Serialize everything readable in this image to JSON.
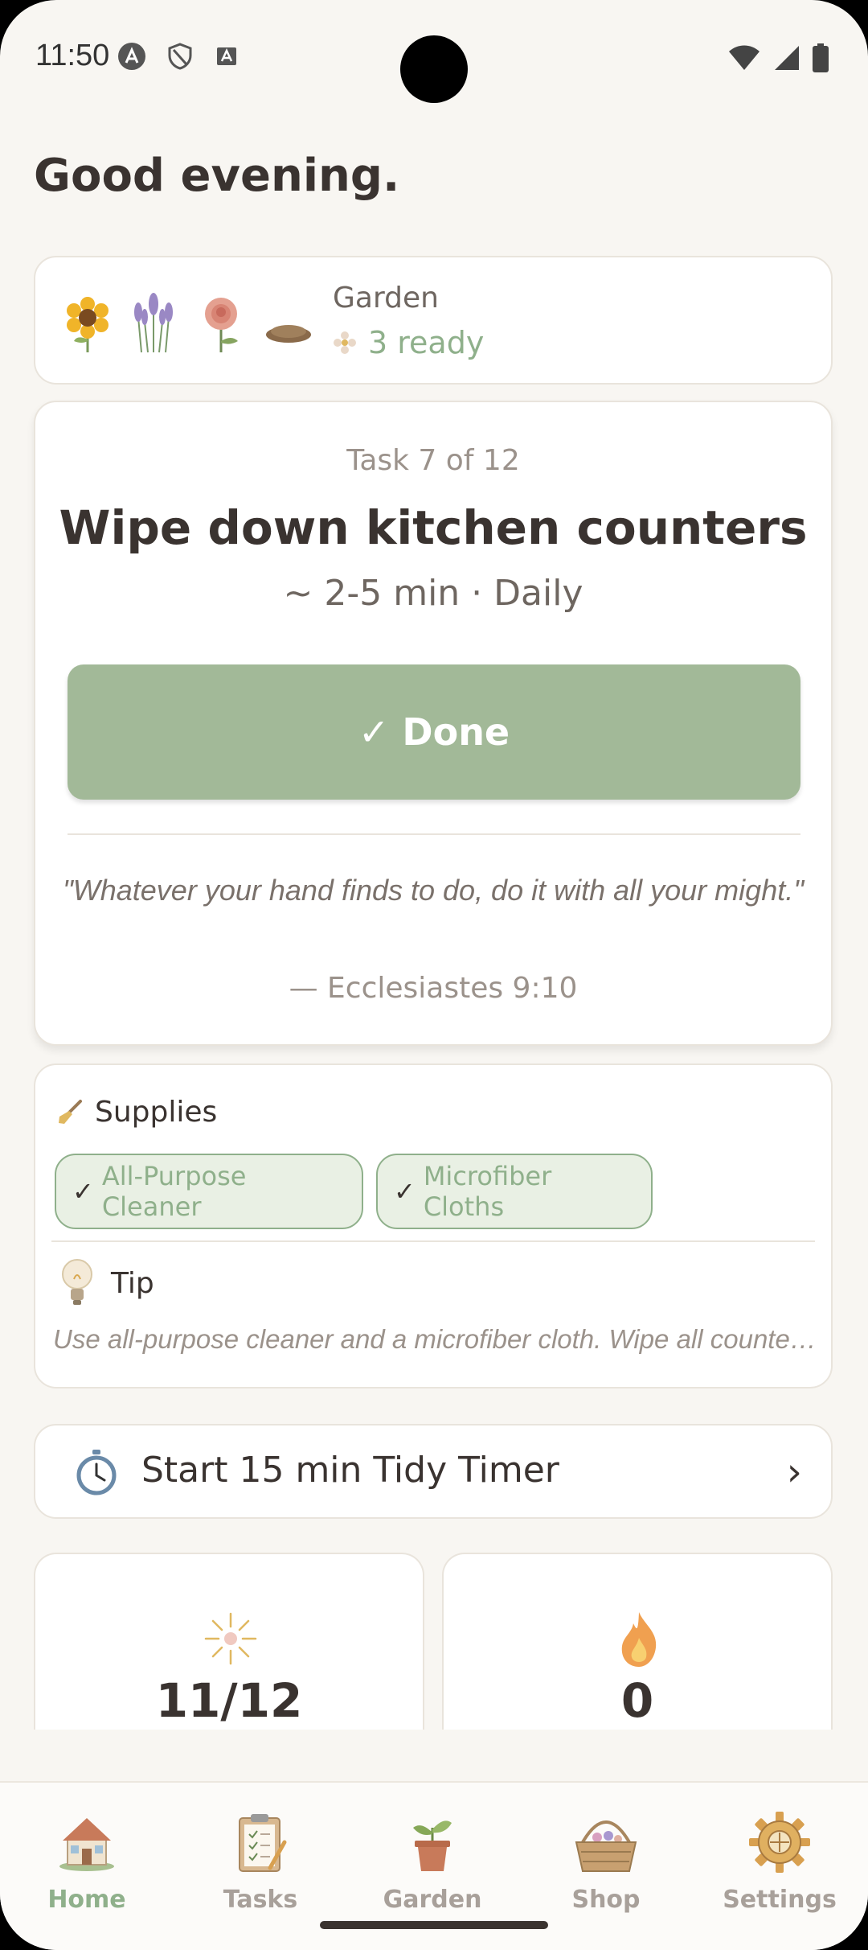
{
  "status_bar": {
    "time": "11:50"
  },
  "greeting": "Good evening.",
  "garden": {
    "title": "Garden",
    "ready": "3 ready"
  },
  "task": {
    "counter": "Task 7 of 12",
    "title": "Wipe down kitchen counters",
    "meta": "~ 2-5 min · Daily",
    "done_label": "✓ Done",
    "quote": "\"Whatever your hand finds to do, do it with all your might.\"",
    "verse": "— Ecclesiastes 9:10"
  },
  "supplies": {
    "title": "Supplies",
    "items": [
      {
        "check": "✓",
        "label": "All-Purpose Cleaner"
      },
      {
        "check": "✓",
        "label": "Microfiber Cloths"
      }
    ],
    "tip_title": "Tip",
    "tip_text": "Use all-purpose cleaner and a microfiber cloth. Wipe all counters, including the back splash and around appliances."
  },
  "timer": {
    "label": "Start 15 min Tidy Timer",
    "chevron": "›"
  },
  "stats": [
    {
      "icon": "sparkle-icon",
      "value": "11/12"
    },
    {
      "icon": "flame-icon",
      "value": "0"
    }
  ],
  "nav": [
    {
      "label": "Home",
      "icon": "house-icon",
      "active": true
    },
    {
      "label": "Tasks",
      "icon": "clipboard-icon"
    },
    {
      "label": "Garden",
      "icon": "plant-pot-icon"
    },
    {
      "label": "Shop",
      "icon": "basket-icon"
    },
    {
      "label": "Settings",
      "icon": "gear-icon"
    }
  ],
  "colors": {
    "accent": "#a2b998",
    "accent_text": "#8fb08b",
    "background": "#f8f6f2"
  }
}
